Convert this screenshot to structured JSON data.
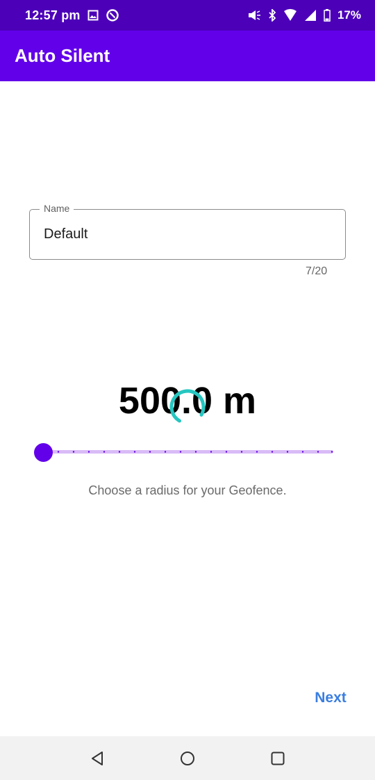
{
  "status_bar": {
    "time": "12:57 pm",
    "battery_percent": "17%",
    "icons": [
      "image-icon",
      "data-saver-icon",
      "speaker-icon",
      "bluetooth-icon",
      "wifi-icon",
      "signal-icon",
      "battery-icon"
    ]
  },
  "app_bar": {
    "title": "Auto Silent"
  },
  "name_field": {
    "label": "Name",
    "value": "Default",
    "counter": "7/20"
  },
  "radius": {
    "display": "500.0 m",
    "slider_fraction": 0.0,
    "hint": "Choose a radius for your Geofence."
  },
  "actions": {
    "next_label": "Next"
  },
  "nav_bar": {
    "icons": [
      "back-icon",
      "home-icon",
      "recents-icon"
    ]
  },
  "colors": {
    "status_bar": "#4c00b8",
    "app_bar": "#6200ea",
    "accent": "#6200ea",
    "slider_track": "#d9bbf7",
    "spinner": "#26c6c0",
    "next": "#3a7ee0"
  }
}
